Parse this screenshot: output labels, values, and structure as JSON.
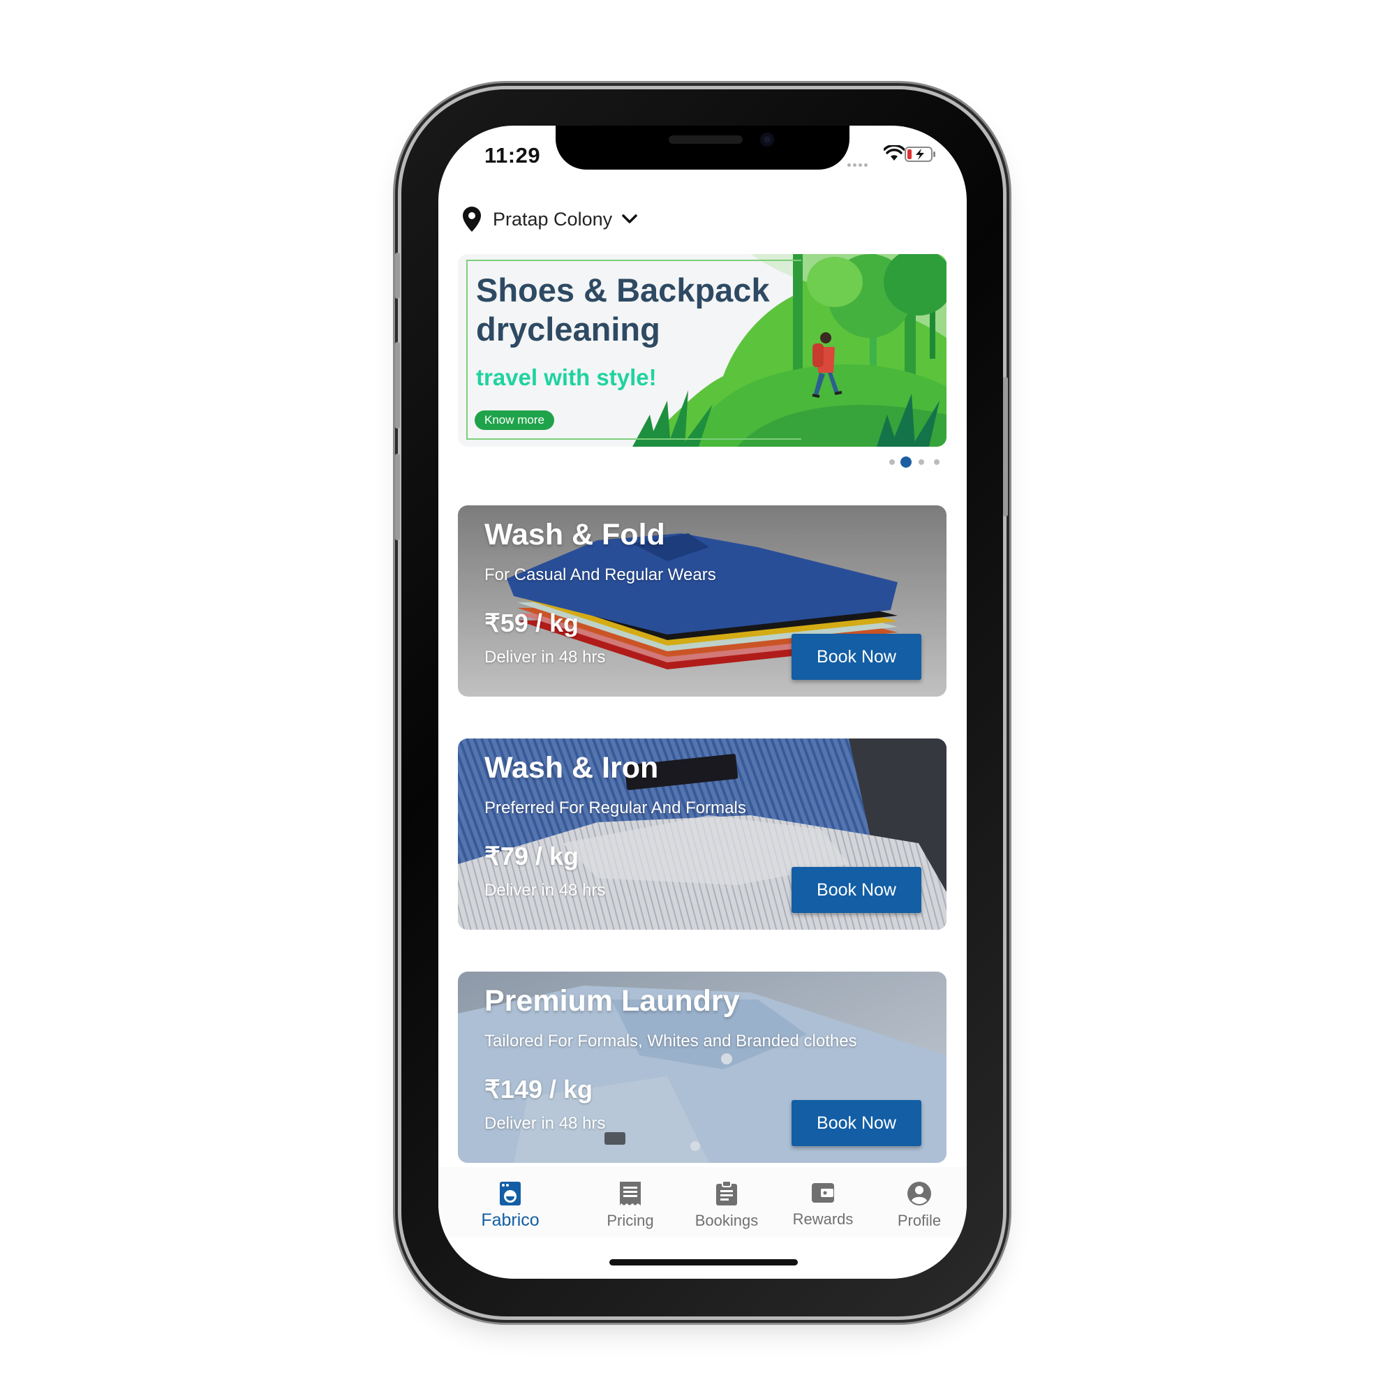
{
  "status_bar": {
    "time": "11:29"
  },
  "location": {
    "label": "Pratap Colony"
  },
  "banner": {
    "title": "Shoes & Backpack drycleaning",
    "tagline": "travel with style!",
    "button_label": "Know more",
    "carousel_total": 4,
    "carousel_active_index": 1
  },
  "services": [
    {
      "title": "Wash & Fold",
      "subtitle": "For Casual And Regular Wears",
      "price": "₹59 / kg",
      "delivery": "Deliver in 48 hrs",
      "button": "Book Now"
    },
    {
      "title": "Wash & Iron",
      "subtitle": "Preferred For Regular And Formals",
      "price": "₹79 / kg",
      "delivery": "Deliver in 48 hrs",
      "button": "Book Now"
    },
    {
      "title": "Premium Laundry",
      "subtitle": "Tailored For Formals, Whites and Branded clothes",
      "price": "₹149 / kg",
      "delivery": "Deliver in 48 hrs",
      "button": "Book Now"
    }
  ],
  "bottom_nav": {
    "active": "Fabrico",
    "items": [
      {
        "label": "Fabrico",
        "icon": "washing-machine-icon"
      },
      {
        "label": "Pricing",
        "icon": "receipt-icon"
      },
      {
        "label": "Bookings",
        "icon": "clipboard-icon"
      },
      {
        "label": "Rewards",
        "icon": "wallet-icon"
      },
      {
        "label": "Profile",
        "icon": "account-circle-icon"
      }
    ]
  },
  "colors": {
    "primary": "#135ea4",
    "banner_title": "#2e4a63",
    "banner_tag": "#1fd3a0",
    "banner_button": "#1fa34a"
  }
}
